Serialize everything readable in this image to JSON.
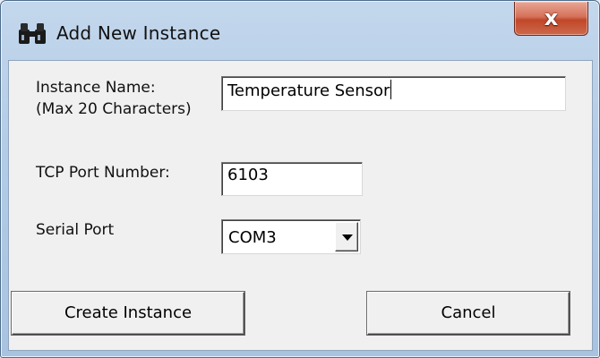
{
  "window": {
    "title": "Add New Instance",
    "close_label": "x"
  },
  "form": {
    "instance_name_label_line1": "Instance Name:",
    "instance_name_label_line2": "(Max 20 Characters)",
    "instance_name_value": "Temperature Sensor",
    "tcp_port_label": "TCP Port Number:",
    "tcp_port_value": "6103",
    "serial_port_label": "Serial Port",
    "serial_port_selected": "COM3"
  },
  "buttons": {
    "create_label": "Create Instance",
    "cancel_label": "Cancel"
  }
}
